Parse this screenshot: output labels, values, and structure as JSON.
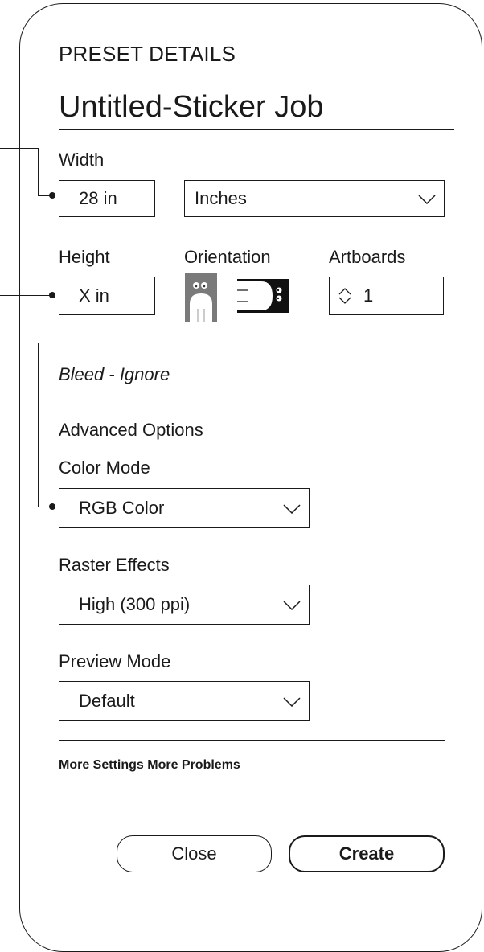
{
  "panel": {
    "section_heading": "PRESET DETAILS",
    "document_title": "Untitled-Sticker Job"
  },
  "width": {
    "label": "Width",
    "value": "28 in"
  },
  "units": {
    "selected": "Inches"
  },
  "height": {
    "label": "Height",
    "value": "X in"
  },
  "orientation": {
    "label": "Orientation"
  },
  "artboards": {
    "label": "Artboards",
    "value": "1"
  },
  "bleed": {
    "label": "Bleed - Ignore"
  },
  "advanced": {
    "heading": "Advanced Options"
  },
  "color_mode": {
    "label": "Color Mode",
    "selected": "RGB Color"
  },
  "raster_effects": {
    "label": "Raster Effects",
    "selected": "High (300 ppi)"
  },
  "preview_mode": {
    "label": "Preview Mode",
    "selected": "Default"
  },
  "footer_link": "More Settings More Problems",
  "buttons": {
    "close": "Close",
    "create": "Create"
  },
  "icons": {
    "chevron": "chevron-down-icon",
    "stepper": "stepper-updown-icon",
    "portrait": "portrait-orientation-icon",
    "landscape": "landscape-orientation-icon"
  }
}
